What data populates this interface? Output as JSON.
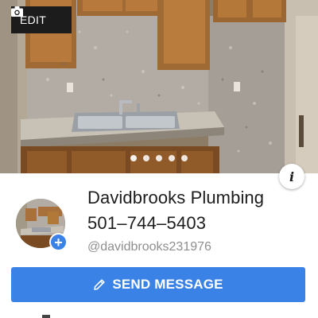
{
  "cover": {
    "edit_label": "EDIT",
    "carousel_total": 5,
    "carousel_active": 1
  },
  "profile": {
    "name": "Davidbrooks Plumbing",
    "phone": "501–744–5403",
    "handle": "@davidbrooks231976",
    "info_glyph": "i",
    "add_glyph": "+"
  },
  "actions": {
    "send_message_label": "SEND MESSAGE"
  },
  "colors": {
    "accent": "#3b82e6",
    "edit_bg": "#1c1c1c",
    "handle_text": "#8e8e8e"
  },
  "icons": {
    "edit": "camera-icon",
    "send": "pencil-icon",
    "info": "info-icon",
    "add": "plus-icon"
  }
}
